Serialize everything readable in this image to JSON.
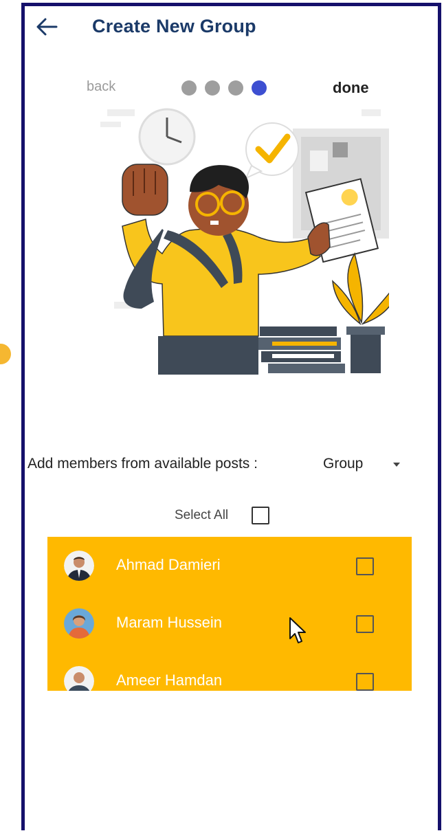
{
  "header": {
    "title": "Create New Group"
  },
  "stepper": {
    "back_label": "back",
    "done_label": "done",
    "total_steps": 4,
    "current_step": 4
  },
  "members_section": {
    "label": "Add members from available posts :",
    "dropdown_value": "Group",
    "select_all_label": "Select All"
  },
  "members": [
    {
      "name": "Ahmad Damieri",
      "checked": false
    },
    {
      "name": "Maram Hussein",
      "checked": false
    },
    {
      "name": "Ameer Hamdan",
      "checked": false
    }
  ],
  "colors": {
    "accent": "#ffb900",
    "title": "#1b3a68",
    "active_dot": "#3d4fd1",
    "frame": "#15106b"
  }
}
